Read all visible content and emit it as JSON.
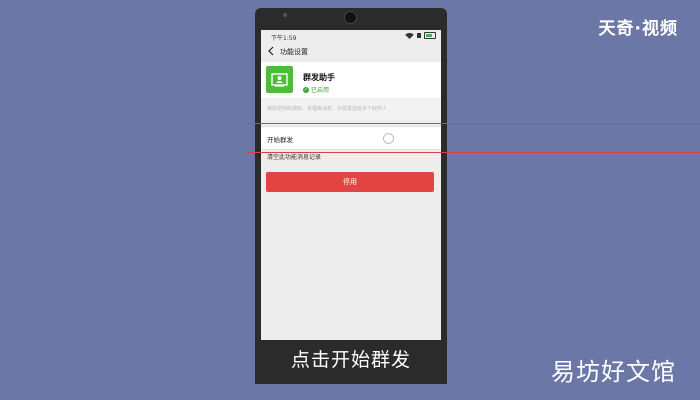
{
  "watermarks": {
    "top_right": "天奇·视频",
    "bottom_right": "易坊好文馆"
  },
  "caption": "点击开始群发",
  "phone": {
    "status_time": "下午1:59",
    "nav_title": "功能设置",
    "app": {
      "name": "群发助手",
      "status": "已启用",
      "icon": "mass-send-icon",
      "icon_color": "#4cbc3a"
    },
    "description": "接能把你的通知、祝福等消息，分别发送给多个收件人",
    "rows": {
      "start_label": "开始群发",
      "clear_label": "清空此功能消息记录"
    },
    "disable_label": "停用",
    "accent_color": "#e24444"
  }
}
